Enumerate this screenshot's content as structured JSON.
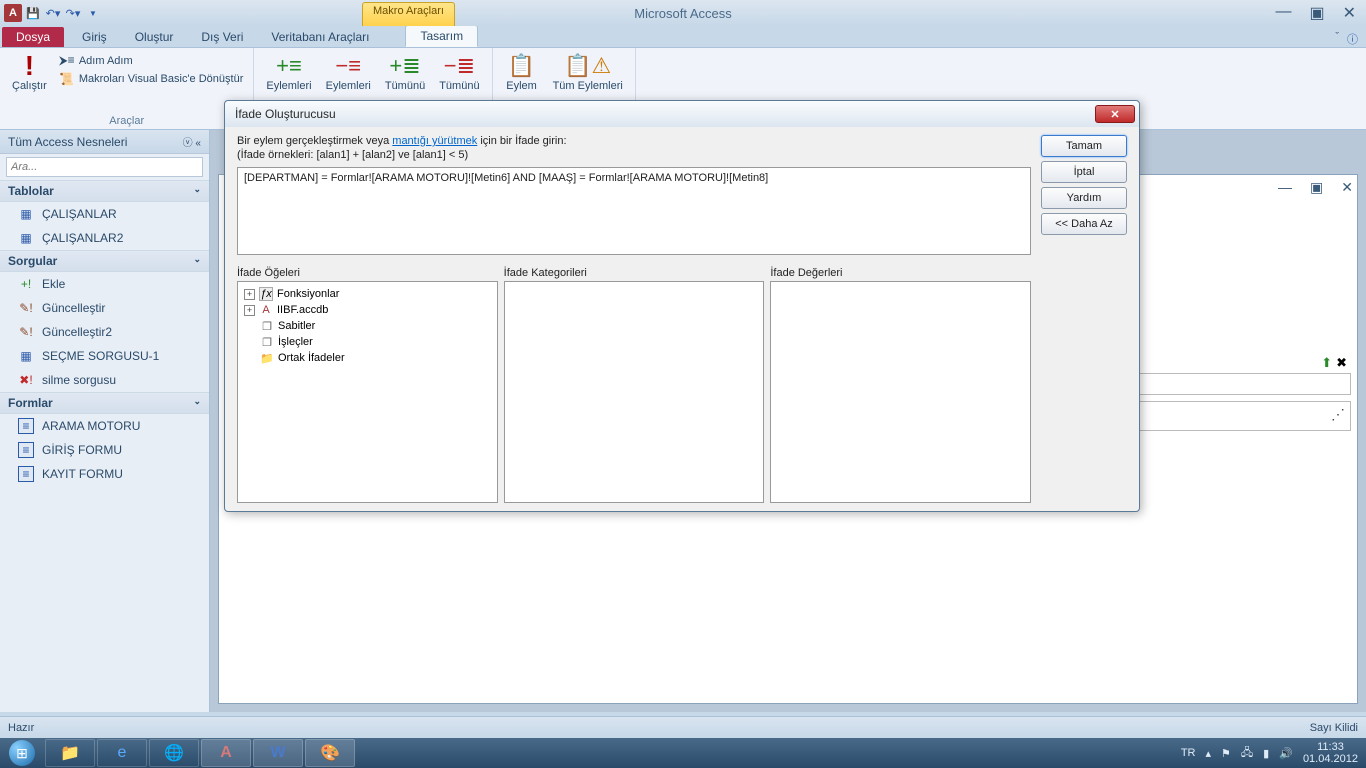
{
  "titlebar": {
    "app_title": "Microsoft Access",
    "context_tab": "Makro Araçları"
  },
  "ribbon_tabs": {
    "file": "Dosya",
    "home": "Giriş",
    "create": "Oluştur",
    "external": "Dış Veri",
    "dbtools": "Veritabanı Araçları",
    "design": "Tasarım"
  },
  "ribbon": {
    "run": "Çalıştır",
    "step": "Adım Adım",
    "convert": "Makroları Visual Basic'e Dönüştür",
    "tools_label": "Araçlar",
    "actions_add": "Eylemleri",
    "actions_del": "Eylemleri",
    "all_exp": "Tümünü",
    "all_col": "Tümünü",
    "action": "Eylem",
    "all_actions": "Tüm Eylemleri"
  },
  "navpane": {
    "header": "Tüm Access Nesneleri",
    "search_placeholder": "Ara...",
    "tables_label": "Tablolar",
    "tables": [
      "ÇALIŞANLAR",
      "ÇALIŞANLAR2"
    ],
    "queries_label": "Sorgular",
    "queries": [
      "Ekle",
      "Güncelleştir",
      "Güncelleştir2",
      "SEÇME SORGUSU-1",
      "silme sorgusu"
    ],
    "forms_label": "Formlar",
    "forms": [
      "ARAMA MOTORU",
      "GİRİŞ FORMU",
      "KAYIT FORMU"
    ]
  },
  "dialog": {
    "title": "İfade Oluşturucusu",
    "instr1_a": "Bir eylem gerçekleştirmek veya ",
    "instr1_link": "mantığı yürütmek",
    "instr1_b": " için bir İfade girin:",
    "instr2": "(İfade örnekleri: [alan1] + [alan2] ve [alan1] < 5)",
    "expression": "[DEPARTMAN] = Formlar![ARAMA MOTORU]![Metin6] AND [MAAŞ] = Formlar![ARAMA MOTORU]![Metin8]",
    "btn_ok": "Tamam",
    "btn_cancel": "İptal",
    "btn_help": "Yardım",
    "btn_less": "<< Daha Az",
    "elements_label": "İfade Öğeleri",
    "categories_label": "İfade Kategorileri",
    "values_label": "İfade Değerleri",
    "tree": {
      "functions": "Fonksiyonlar",
      "db": "IIBF.accdb",
      "constants": "Sabitler",
      "operators": "İşleçler",
      "common": "Ortak İfadeler"
    }
  },
  "statusbar": {
    "ready": "Hazır",
    "numlock": "Sayı Kilidi"
  },
  "taskbar": {
    "lang": "TR",
    "time": "11:33",
    "date": "01.04.2012"
  }
}
